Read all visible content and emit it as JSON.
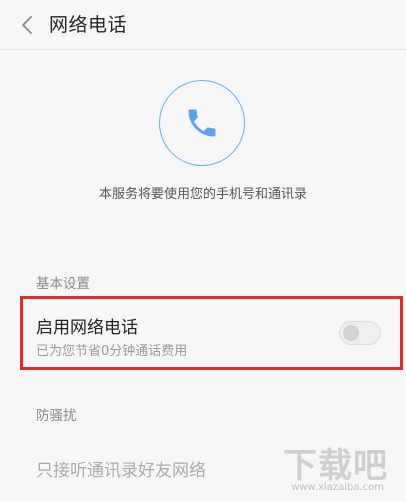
{
  "header": {
    "title": "网络电话"
  },
  "hero": {
    "icon": "phone-icon",
    "accent_color": "#5aa3ee",
    "description": "本服务将要使用您的手机号和通讯录"
  },
  "basic_settings": {
    "section_label": "基本设置",
    "enable_item": {
      "title": "启用网络电话",
      "subtitle": "已为您节省0分钟通话费用",
      "toggle_on": false
    }
  },
  "anti_harassment": {
    "section_label": "防骚扰",
    "item_label": "只接听通讯录好友网络"
  },
  "watermark": {
    "brand": "下载吧",
    "url": "www.xiazaiba.com"
  },
  "highlight_color": "#e22b2b"
}
